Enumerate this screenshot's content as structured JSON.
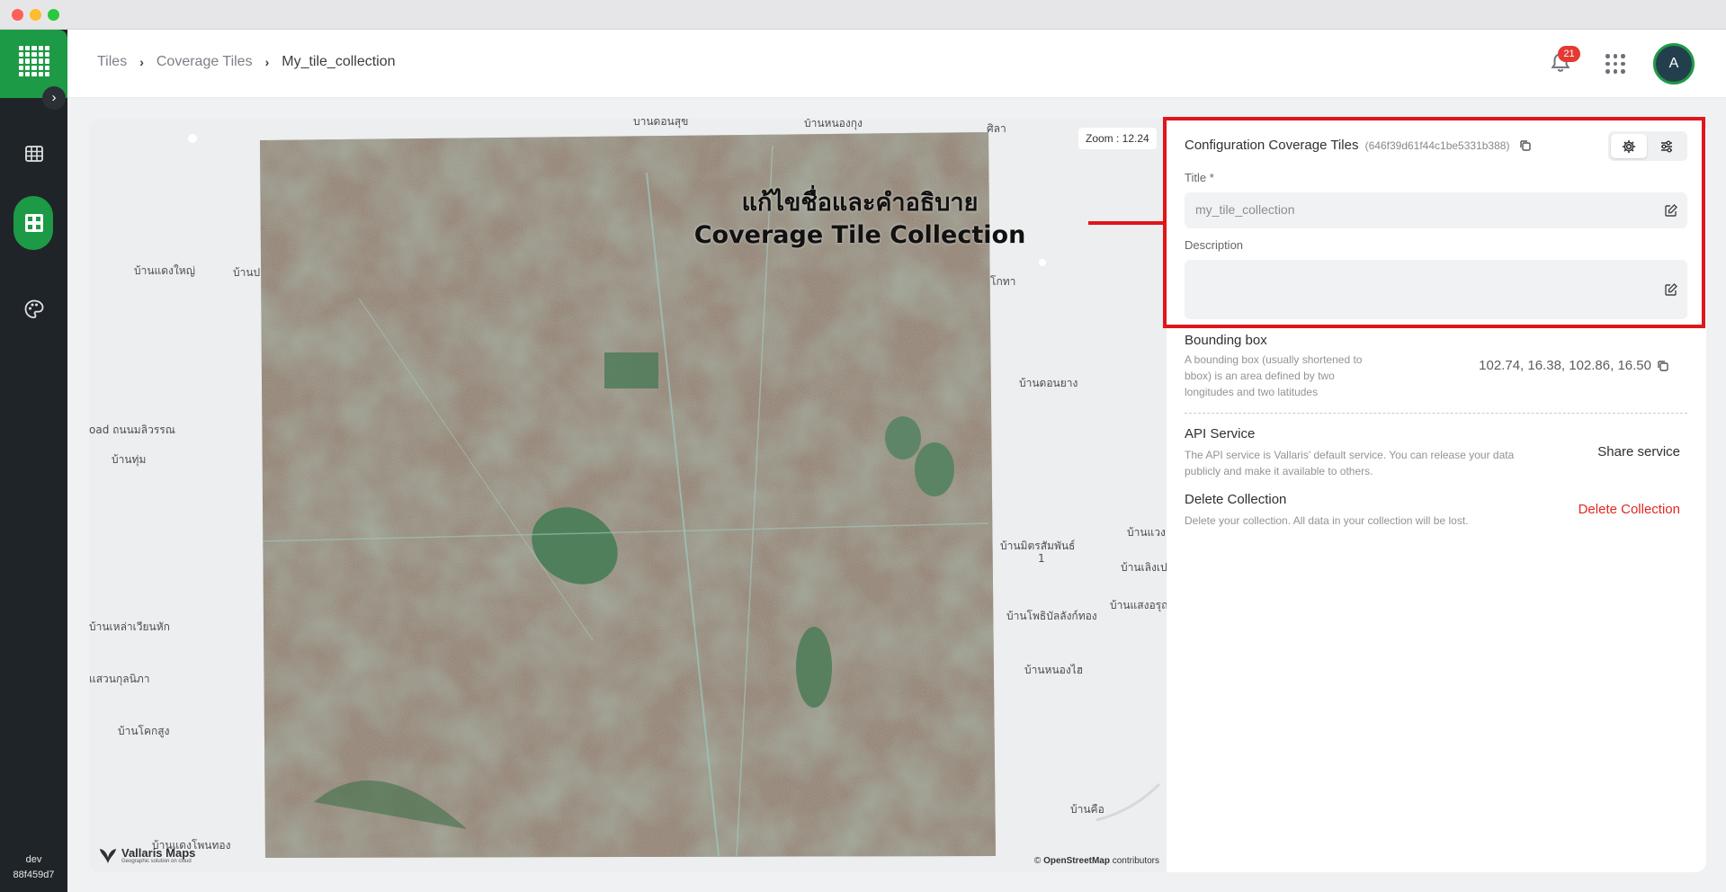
{
  "header": {
    "breadcrumb": [
      "Tiles",
      "Coverage Tiles",
      "My_tile_collection"
    ],
    "notifications_count": "21",
    "avatar_initial": "A"
  },
  "sidebar": {
    "env": "dev",
    "version": "88f459d7",
    "icons": [
      "logo-grid-icon",
      "table-grid-icon",
      "tiles-icon",
      "palette-icon"
    ]
  },
  "map": {
    "zoom_label": "Zoom : 12.24",
    "attribution_prefix": "©",
    "attribution_link": "OpenStreetMap",
    "attribution_suffix": "contributors",
    "logo_title": "Vallaris Maps",
    "logo_subtitle": "Geographic solution on cloud",
    "annotation_line1": "แก้ไขชื่อและคำอธิบาย",
    "annotation_line2": "Coverage Tile Collection",
    "places": [
      "บ้านดอนสุข",
      "บ้านหนองกุง",
      "ศิลา",
      "บ้านแดงใหญ่",
      "บ้านป",
      "โกทา",
      "บ้านดอนยาง",
      "oad ถนนมลิวรรณ",
      "บ้านทุ่ม",
      "บ้านมิตรสัมพันธ์",
      "1",
      "บ้านเลิงเป",
      "บ้านแวง",
      "บ้านโพธิบัลลังก์ทอง",
      "บ้านแสงอรุณ",
      "บ้านหนองไฮ",
      "บ้านเหล่าเวียนหัก",
      "แสวนกุลนิภา",
      "บ้านโคกสูง",
      "บ้านแดงโพนทอง",
      "บ้านคือ"
    ]
  },
  "panel": {
    "title": "Configuration Coverage Tiles",
    "collection_id": "(646f39d61f44c1be5331b388)",
    "title_label": "Title *",
    "title_value": "my_tile_collection",
    "description_label": "Description",
    "description_value": "",
    "bbox_title": "Bounding box",
    "bbox_desc": "A bounding box (usually shortened to bbox) is an area defined by two longitudes and two latitudes",
    "bbox_value": "102.74, 16.38, 102.86, 16.50",
    "api_title": "API Service",
    "api_desc": "The API service is Vallaris' default service. You can release your data publicly and make it available to others.",
    "share_label": "Share service",
    "delete_title": "Delete Collection",
    "delete_desc": "Delete your collection. All data in your collection will be lost.",
    "delete_label": "Delete Collection"
  },
  "colors": {
    "brand_green": "#1d9a45",
    "sidebar_dark": "#1f2428",
    "highlight_red": "#e0161a",
    "delete_red": "#e0281f"
  }
}
